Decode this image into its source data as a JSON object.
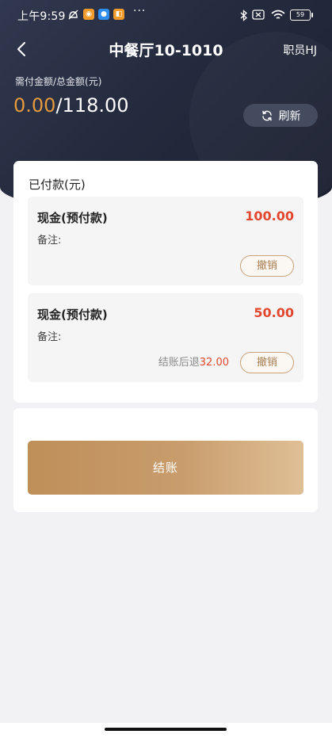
{
  "status_bar": {
    "time": "上午9:59",
    "battery": "59",
    "more": "···"
  },
  "nav": {
    "title": "中餐厅10-1010",
    "user": "职员HJ"
  },
  "summary": {
    "label": "需付金额/总金额(元)",
    "paid_amount": "0.00",
    "separator": "/",
    "total_amount": "118.00",
    "refresh_label": "刷新"
  },
  "payments": {
    "section_title": "已付款(元)",
    "items": [
      {
        "name": "现金(预付款)",
        "amount": "100.00",
        "remark_label": "备注:",
        "cancel_label": "撤销"
      },
      {
        "name": "现金(预付款)",
        "amount": "50.00",
        "remark_label": "备注:",
        "refund_label": "结账后退",
        "refund_amount": "32.00",
        "cancel_label": "撤销"
      }
    ]
  },
  "checkout": {
    "label": "结账"
  },
  "colors": {
    "accent_orange": "#e59a3b",
    "amount_red": "#e4472f",
    "gold_button": "#c89c6c",
    "header_dark": "#252b3e"
  }
}
